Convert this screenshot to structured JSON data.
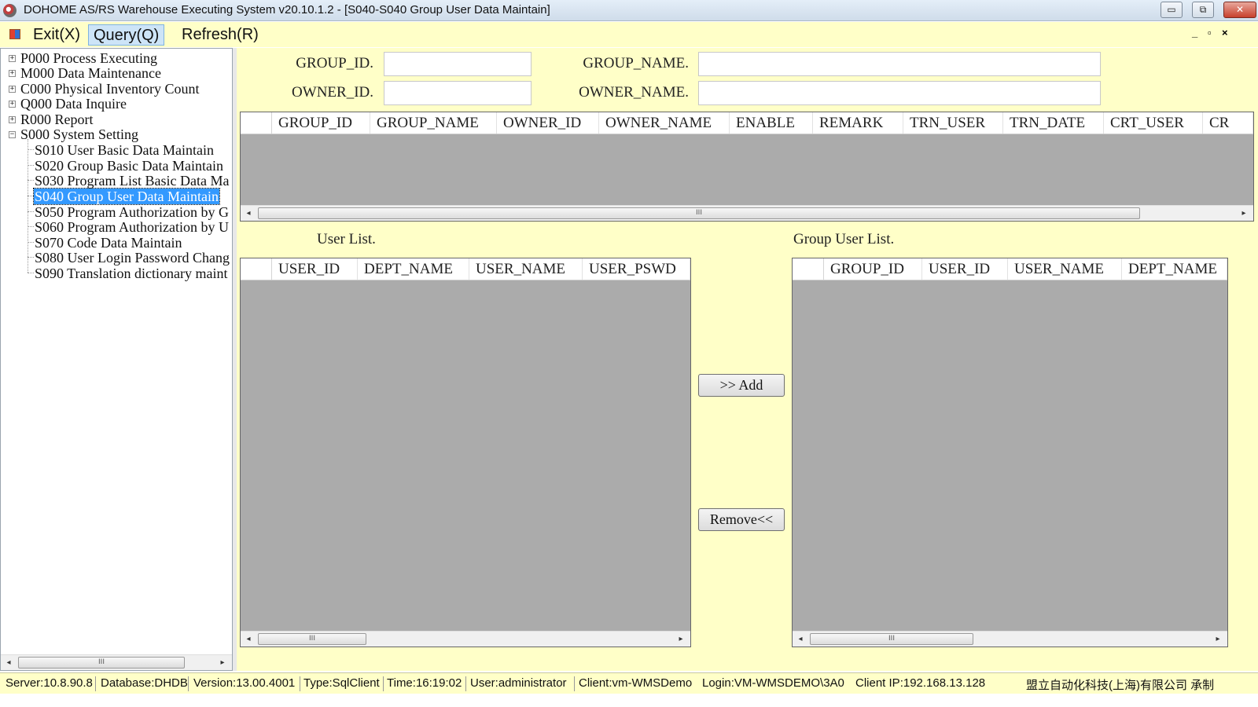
{
  "window": {
    "title": "DOHOME AS/RS Warehouse Executing System v20.10.1.2 - [S040-S040 Group User Data Maintain]",
    "min_glyph": "▭",
    "max_glyph": "⧉",
    "close_glyph": "✕"
  },
  "menu": {
    "exit": "Exit(X)",
    "query": "Query(Q)",
    "refresh": "Refresh(R)",
    "mdi_min": "_",
    "mdi_restore": "▫",
    "mdi_close": "×"
  },
  "tree": {
    "nodes": [
      {
        "label": "P000 Process Executing",
        "expander": "+"
      },
      {
        "label": "M000 Data Maintenance",
        "expander": "+"
      },
      {
        "label": "C000 Physical Inventory Count",
        "expander": "+"
      },
      {
        "label": "Q000 Data Inquire",
        "expander": "+"
      },
      {
        "label": "R000 Report",
        "expander": "+"
      },
      {
        "label": "S000 System Setting",
        "expander": "−"
      }
    ],
    "children": [
      {
        "label": "S010 User Basic Data Maintain"
      },
      {
        "label": "S020 Group Basic Data Maintain"
      },
      {
        "label": "S030 Program List Basic Data Ma"
      },
      {
        "label": "S040 Group User Data Maintain",
        "selected": true
      },
      {
        "label": "S050 Program Authorization by G"
      },
      {
        "label": "S060 Program Authorization by U"
      },
      {
        "label": "S070 Code Data Maintain"
      },
      {
        "label": "S080 User Login Password Chang"
      },
      {
        "label": "S090 Translation dictionary maint"
      }
    ]
  },
  "form": {
    "group_id_label": "GROUP_ID.",
    "group_name_label": "GROUP_NAME.",
    "owner_id_label": "OWNER_ID.",
    "owner_name_label": "OWNER_NAME.",
    "group_id_value": "",
    "group_name_value": "",
    "owner_id_value": "",
    "owner_name_value": ""
  },
  "group_grid": {
    "columns": [
      "GROUP_ID",
      "GROUP_NAME",
      "OWNER_ID",
      "OWNER_NAME",
      "ENABLE",
      "REMARK",
      "TRN_USER",
      "TRN_DATE",
      "CRT_USER",
      "CR"
    ]
  },
  "user_list": {
    "label": "User List.",
    "columns": [
      "USER_ID",
      "DEPT_NAME",
      "USER_NAME",
      "USER_PSWD"
    ]
  },
  "group_user_list": {
    "label": "Group User List.",
    "columns": [
      "GROUP_ID",
      "USER_ID",
      "USER_NAME",
      "DEPT_NAME"
    ]
  },
  "buttons": {
    "add": ">> Add",
    "remove": "Remove<<"
  },
  "scroll": {
    "left": "◂",
    "right": "▸",
    "grip": "III"
  },
  "status": {
    "server": "Server:10.8.90.8",
    "database": "Database:DHDB",
    "version": "Version:13.00.4001",
    "type": "Type:SqlClient",
    "time": "Time:16:19:02",
    "user": "User:administrator",
    "client": "Client:vm-WMSDemo",
    "login": "Login:VM-WMSDEMO\\3A0",
    "client_ip": "Client IP:192.168.13.128",
    "company": "盟立自动化科技(上海)有限公司 承制"
  }
}
